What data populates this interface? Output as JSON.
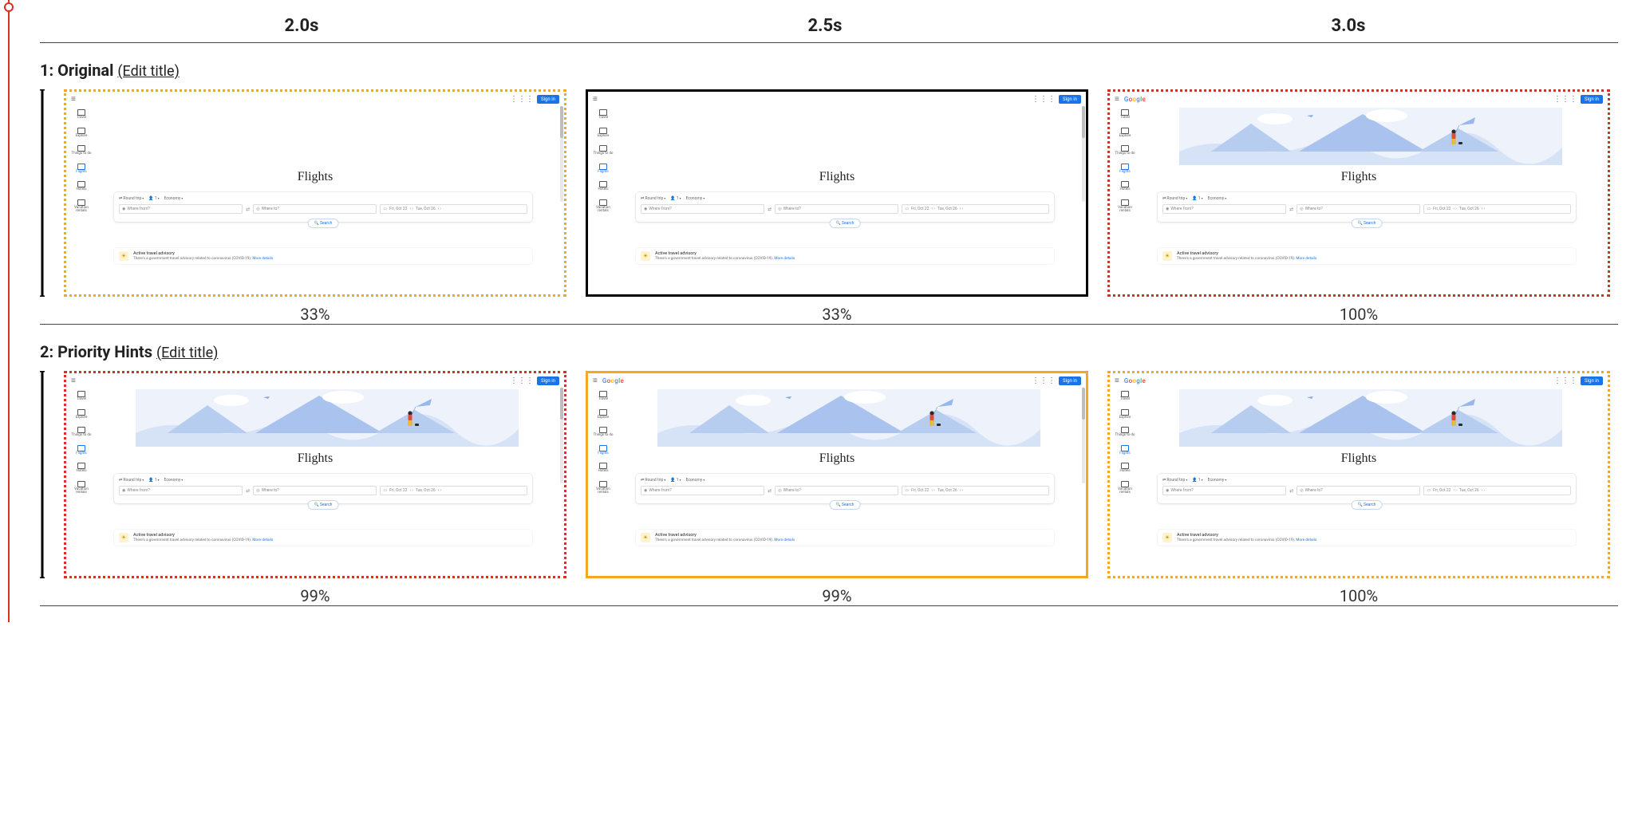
{
  "times": [
    "2.0s",
    "2.5s",
    "3.0s"
  ],
  "sections": [
    {
      "index": "1",
      "title": "Original",
      "edit_label": "(Edit title)",
      "frames": [
        {
          "border": "dot-orange",
          "pct": "33%",
          "hero": false,
          "logo": false,
          "scroll": true
        },
        {
          "border": "solid-black",
          "pct": "33%",
          "hero": false,
          "logo": false,
          "scroll": true
        },
        {
          "border": "dot-red",
          "pct": "100%",
          "hero": true,
          "logo": true,
          "scroll": false
        }
      ]
    },
    {
      "index": "2",
      "title": "Priority Hints",
      "edit_label": "(Edit title)",
      "frames": [
        {
          "border": "dot-red",
          "pct": "99%",
          "hero": true,
          "logo": false,
          "scroll": true
        },
        {
          "border": "solid-orange",
          "pct": "99%",
          "hero": true,
          "logo": true,
          "scroll": true
        },
        {
          "border": "dot-orange",
          "pct": "100%",
          "hero": true,
          "logo": true,
          "scroll": false
        }
      ]
    }
  ],
  "gflights": {
    "sign_in": "Sign in",
    "logo_text": "Google",
    "nav": [
      "Travel",
      "Explore",
      "Things to do",
      "Flights",
      "Hotels",
      "Vacation rentals"
    ],
    "nav_active_index": 3,
    "title": "Flights",
    "chips": [
      "Round trip",
      "1",
      "Economy"
    ],
    "from_placeholder": "Where from?",
    "to_placeholder": "Where to?",
    "date1": "Fri, Oct 22",
    "date2": "Tue, Oct 26",
    "search_label": "Search",
    "advisory_title": "Active travel advisory",
    "advisory_sub": "There's a government travel advisory related to coronavirus (COVID-19).",
    "advisory_link": "More details"
  }
}
